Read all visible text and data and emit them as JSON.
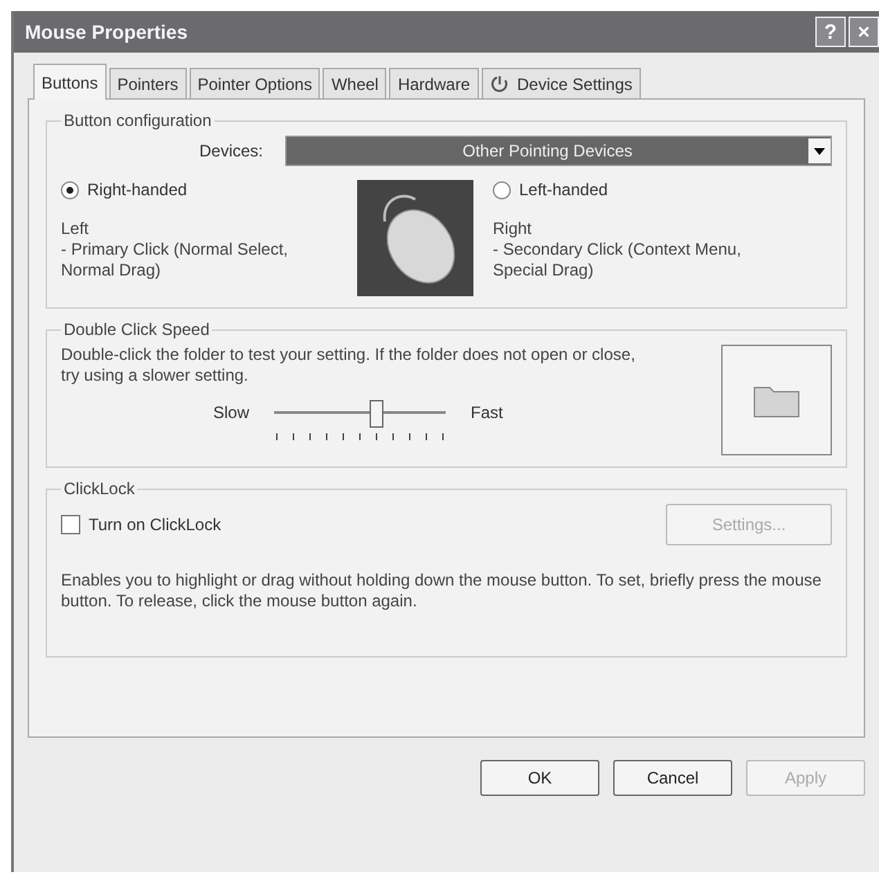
{
  "window": {
    "title": "Mouse Properties",
    "title_buttons": [
      "?",
      "×"
    ]
  },
  "tabs": [
    {
      "label": "Buttons",
      "selected": true,
      "kind": "plain"
    },
    {
      "label": "Pointers",
      "selected": false,
      "kind": "plain"
    },
    {
      "label": "Pointer Options",
      "selected": false,
      "kind": "plain"
    },
    {
      "label": "Wheel",
      "selected": false,
      "kind": "plain"
    },
    {
      "label": "Hardware",
      "selected": false,
      "kind": "plain"
    },
    {
      "label": "Device Settings",
      "selected": false,
      "kind": "icon"
    }
  ],
  "button_configuration": {
    "title": "Button configuration",
    "devices_label": "Devices:",
    "devices_value": "Other Pointing Devices",
    "handedness": [
      {
        "label": "Right-handed",
        "selected": true
      },
      {
        "label": "Left-handed",
        "selected": false
      }
    ],
    "left": {
      "heading": "Left",
      "description": "- Primary Click (Normal Select, Normal Drag)"
    },
    "right": {
      "heading": "Right",
      "description": "- Secondary Click (Context Menu, Special Drag)"
    }
  },
  "double_click_speed": {
    "title": "Double Click Speed",
    "description": "Double-click the folder to test your setting.  If the folder does not open or close, try using a slower setting.",
    "slow_label": "Slow",
    "fast_label": "Fast",
    "level": 0.6
  },
  "clicklock": {
    "title": "ClickLock",
    "checkbox": {
      "label": "Turn on ClickLock",
      "checked": false
    },
    "settings_button": {
      "label": "Settings...",
      "disabled": true
    },
    "description": "Enables you to highlight or drag without holding down the mouse button.  To set, briefly press the mouse button.  To release, click the mouse button again."
  },
  "buttons": [
    {
      "label": "OK",
      "disabled": false
    },
    {
      "label": "Cancel",
      "disabled": false
    },
    {
      "label": "Apply",
      "disabled": true
    }
  ]
}
